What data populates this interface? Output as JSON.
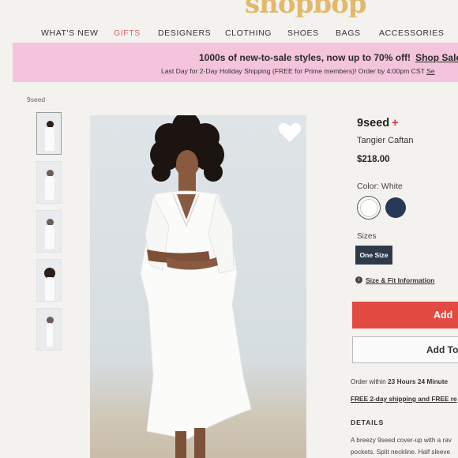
{
  "logo_text": "shopbop",
  "nav": {
    "items": [
      "WHAT'S NEW",
      "GIFTS",
      "DESIGNERS",
      "CLOTHING",
      "SHOES",
      "BAGS",
      "ACCESSORIES"
    ],
    "highlight_color": "#e0626a"
  },
  "promo": {
    "headline": "1000s of new-to-sale styles, now up to 70% off!",
    "sale_link": "Shop Sale",
    "subline": "Last Day for 2-Day Holiday Shipping (FREE for Prime members)! Order by 4:00pm CST",
    "subline_link": "Se",
    "background": "#f4c3dc"
  },
  "breadcrumb": "9seed",
  "product": {
    "brand": "9seed",
    "brand_plus": "+",
    "name": "Tangier Caftan",
    "price": "$218.00",
    "color_label": "Color: White",
    "swatches": [
      {
        "name": "White",
        "color": "#ffffff"
      },
      {
        "name": "Navy",
        "color": "#273954"
      }
    ],
    "sizes_label": "Sizes",
    "size_option": "One Size",
    "fit_link": "Size & Fit Information",
    "add_to_bag": "Add",
    "add_to_wishlist": "Add To",
    "order_within_prefix": "Order within",
    "order_within_time": "23 Hours 24 Minute",
    "shipping_text": "FREE 2-day shipping and FREE re",
    "details_heading": "DETAILS",
    "description_line1": "A breezy 9seed cover-up with a rav",
    "description_line2": "pockets. Split neckline. Half sleeve"
  },
  "thumbnails_count": 5,
  "accent_red": "#e14b41"
}
